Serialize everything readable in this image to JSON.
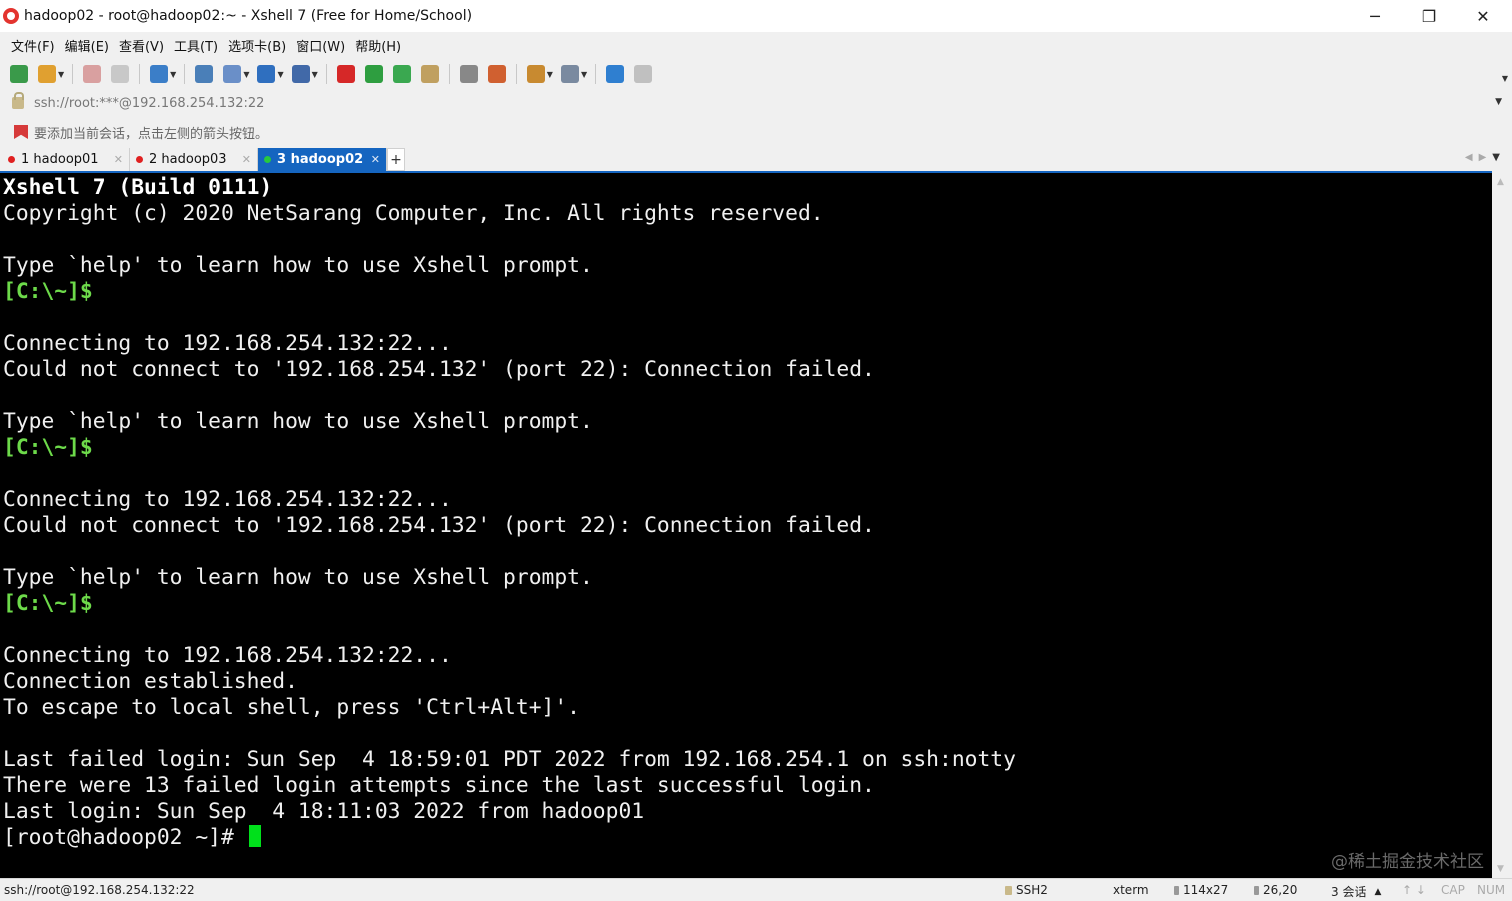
{
  "window": {
    "title": "hadoop02 - root@hadoop02:~ - Xshell 7 (Free for Home/School)",
    "minimize_glyph": "─",
    "restore_glyph": "❐",
    "close_glyph": "✕"
  },
  "menu": [
    "文件(F)",
    "编辑(E)",
    "查看(V)",
    "工具(T)",
    "选项卡(B)",
    "窗口(W)",
    "帮助(H)"
  ],
  "toolbar": {
    "icons": [
      {
        "name": "new-session-icon",
        "color": "#3a9a4a"
      },
      {
        "name": "open-folder-icon",
        "color": "#e0a030",
        "dropdown": true
      },
      {
        "sep": true
      },
      {
        "name": "disconnect-icon",
        "color": "#d9a0a0"
      },
      {
        "name": "reconnect-icon",
        "color": "#c8c8c8"
      },
      {
        "sep": true
      },
      {
        "name": "copy-session-icon",
        "color": "#3b7ec8",
        "dropdown": true
      },
      {
        "sep": true
      },
      {
        "name": "find-icon",
        "color": "#4a7fb8"
      },
      {
        "name": "transfer-icon",
        "color": "#6a8fc8",
        "dropdown": true
      },
      {
        "name": "globe-icon",
        "color": "#2f6fbf",
        "dropdown": true
      },
      {
        "name": "font-icon",
        "color": "#4169a8",
        "dropdown": true
      },
      {
        "sep": true
      },
      {
        "name": "xshell-red-icon",
        "color": "#d62828"
      },
      {
        "name": "xftp-green-icon",
        "color": "#2e9e40"
      },
      {
        "name": "fullscreen-icon",
        "color": "#3aa850"
      },
      {
        "name": "lock-toolbar-icon",
        "color": "#c0a060"
      },
      {
        "sep": true
      },
      {
        "name": "keyboard-icon",
        "color": "#888888"
      },
      {
        "name": "highlight-icon",
        "color": "#d06030"
      },
      {
        "sep": true
      },
      {
        "name": "script-icon",
        "color": "#c88a30",
        "dropdown": true
      },
      {
        "name": "layout-icon",
        "color": "#7a8aa0",
        "dropdown": true
      },
      {
        "sep": true
      },
      {
        "name": "help-icon",
        "color": "#2f7fd0"
      },
      {
        "name": "chat-icon",
        "color": "#c0c0c0"
      }
    ]
  },
  "address": {
    "value": "ssh://root:***@192.168.254.132:22"
  },
  "hint": {
    "text": "要添加当前会话，点击左侧的箭头按钮。"
  },
  "tabs": [
    {
      "label": "1 hadoop01",
      "active": false
    },
    {
      "label": "2 hadoop03",
      "active": false
    },
    {
      "label": "3 hadoop02",
      "active": true
    }
  ],
  "tab_add": "+",
  "terminal": {
    "lines": [
      {
        "text": "Xshell 7 (Build 0111)",
        "style": "bold"
      },
      {
        "text": "Copyright (c) 2020 NetSarang Computer, Inc. All rights reserved.",
        "style": ""
      },
      {
        "text": "",
        "style": ""
      },
      {
        "text": "Type `help' to learn how to use Xshell prompt.",
        "style": ""
      },
      {
        "text": "[C:\\~]$",
        "style": "green"
      },
      {
        "text": "",
        "style": ""
      },
      {
        "text": "Connecting to 192.168.254.132:22...",
        "style": ""
      },
      {
        "text": "Could not connect to '192.168.254.132' (port 22): Connection failed.",
        "style": ""
      },
      {
        "text": "",
        "style": ""
      },
      {
        "text": "Type `help' to learn how to use Xshell prompt.",
        "style": ""
      },
      {
        "text": "[C:\\~]$",
        "style": "green"
      },
      {
        "text": "",
        "style": ""
      },
      {
        "text": "Connecting to 192.168.254.132:22...",
        "style": ""
      },
      {
        "text": "Could not connect to '192.168.254.132' (port 22): Connection failed.",
        "style": ""
      },
      {
        "text": "",
        "style": ""
      },
      {
        "text": "Type `help' to learn how to use Xshell prompt.",
        "style": ""
      },
      {
        "text": "[C:\\~]$",
        "style": "green"
      },
      {
        "text": "",
        "style": ""
      },
      {
        "text": "Connecting to 192.168.254.132:22...",
        "style": ""
      },
      {
        "text": "Connection established.",
        "style": ""
      },
      {
        "text": "To escape to local shell, press 'Ctrl+Alt+]'.",
        "style": ""
      },
      {
        "text": "",
        "style": ""
      },
      {
        "text": "Last failed login: Sun Sep  4 18:59:01 PDT 2022 from 192.168.254.1 on ssh:notty",
        "style": ""
      },
      {
        "text": "There were 13 failed login attempts since the last successful login.",
        "style": ""
      },
      {
        "text": "Last login: Sun Sep  4 18:11:03 2022 from hadoop01",
        "style": ""
      }
    ],
    "prompt": "[root@hadoop02 ~]# ",
    "watermark": "@稀土掘金技术社区"
  },
  "status": {
    "connection": "ssh://root@192.168.254.132:22",
    "protocol": "SSH2",
    "term": "xterm",
    "size": "114x27",
    "cursor": "26,20",
    "sessions": "3 会话",
    "sessions_arrow": "▲",
    "caps": "CAP",
    "num": "NUM"
  }
}
